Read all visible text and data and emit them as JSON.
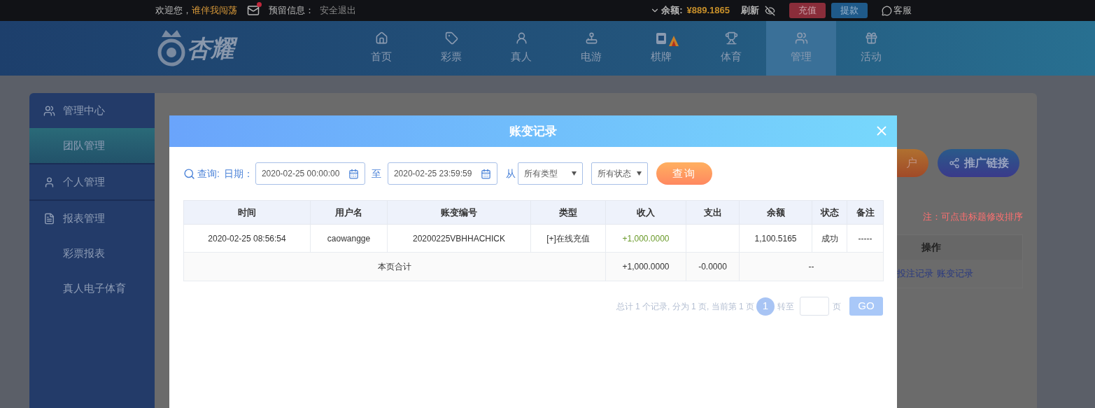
{
  "top_bar": {
    "welcome": "欢迎您，",
    "username": "谁伴我闯荡",
    "has_unread": true,
    "reserved_label": "预留信息：",
    "logout": "安全退出",
    "balance_label": "余额:",
    "balance": "¥889.1865",
    "refresh": "刷新",
    "deposit": "充值",
    "withdraw": "提款",
    "service": "客服"
  },
  "logo": {
    "text": "杏耀"
  },
  "nav": [
    {
      "label": "首页",
      "selected": false
    },
    {
      "label": "彩票",
      "selected": false
    },
    {
      "label": "真人",
      "selected": false
    },
    {
      "label": "电游",
      "selected": false
    },
    {
      "label": "棋牌",
      "selected": false,
      "hot": true
    },
    {
      "label": "体育",
      "selected": false
    },
    {
      "label": "管理",
      "selected": true
    },
    {
      "label": "活动",
      "selected": false
    }
  ],
  "sidebar": {
    "items": [
      {
        "label": "管理中心",
        "selected": false,
        "children": [
          {
            "label": "团队管理",
            "selected": true
          }
        ]
      },
      {
        "label": "个人管理",
        "selected": false
      },
      {
        "label": "报表管理",
        "selected": false,
        "children": [
          {
            "label": "彩票报表",
            "selected": false
          },
          {
            "label": "真人电子体育",
            "selected": false
          }
        ]
      }
    ]
  },
  "page": {
    "open_account_button": "户",
    "promo_button": "推广链接",
    "note": "注：可点击标题修改排序",
    "table_header": "操作",
    "links": [
      "投注记录",
      "账变记录"
    ]
  },
  "dialog": {
    "title": "账变记录",
    "filters": {
      "query_label": "查询:",
      "date_label": "日期：",
      "date_from": "2020-02-25 00:00:00",
      "to_label": "至",
      "date_to": "2020-02-25 23:59:59",
      "from_label": "从",
      "type_select": "所有类型",
      "status_select": "所有状态",
      "query_button": "查询"
    },
    "table": {
      "columns": [
        "时间",
        "用户名",
        "账变编号",
        "类型",
        "收入",
        "支出",
        "余额",
        "状态",
        "备注"
      ],
      "rows": [
        {
          "kind": "data",
          "cells": [
            "2020-02-25 08:56:54",
            "caowangge",
            "20200225VBHHACHICK",
            "[+]在线充值",
            "+1,000.0000",
            "",
            "1,100.5165",
            "成功",
            "-----"
          ]
        },
        {
          "kind": "total",
          "label": "本页合计",
          "income": "+1,000.0000",
          "expense": "-0.0000",
          "rest": "--"
        }
      ]
    },
    "pagination": {
      "summary": "总计 1 个记录, 分为 1 页, 当前第 1 页",
      "pages": [
        {
          "label": "1",
          "selected": true
        }
      ],
      "goto_label": "转至",
      "page_unit": "页",
      "go_button": "GO"
    }
  }
}
